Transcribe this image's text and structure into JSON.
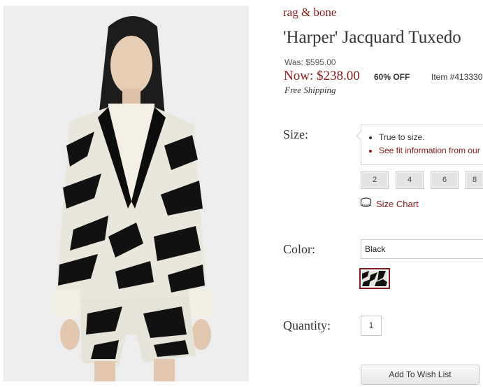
{
  "product": {
    "brand": "rag & bone",
    "title": "'Harper' Jacquard Tuxedo",
    "was_price": "Was: $595.00",
    "now_price": "Now: $238.00",
    "discount": "60% OFF",
    "item_number": "Item #413330",
    "shipping": "Free Shipping",
    "image_alt": "model wearing black and white jacquard tuxedo jacket and shorts"
  },
  "size": {
    "label": "Size:",
    "tip_items": [
      "True to size.",
      "See fit information from our"
    ],
    "options": [
      "2",
      "4",
      "6",
      "8"
    ],
    "chart_label": "Size Chart"
  },
  "color": {
    "label": "Color:",
    "selected": "Black"
  },
  "quantity": {
    "label": "Quantity:",
    "value": "1"
  },
  "actions": {
    "wish_list": "Add To Wish List"
  },
  "colors": {
    "accent": "#8b1a1a",
    "button_bg": "#e4e4e4",
    "border": "#c8c8c8"
  }
}
